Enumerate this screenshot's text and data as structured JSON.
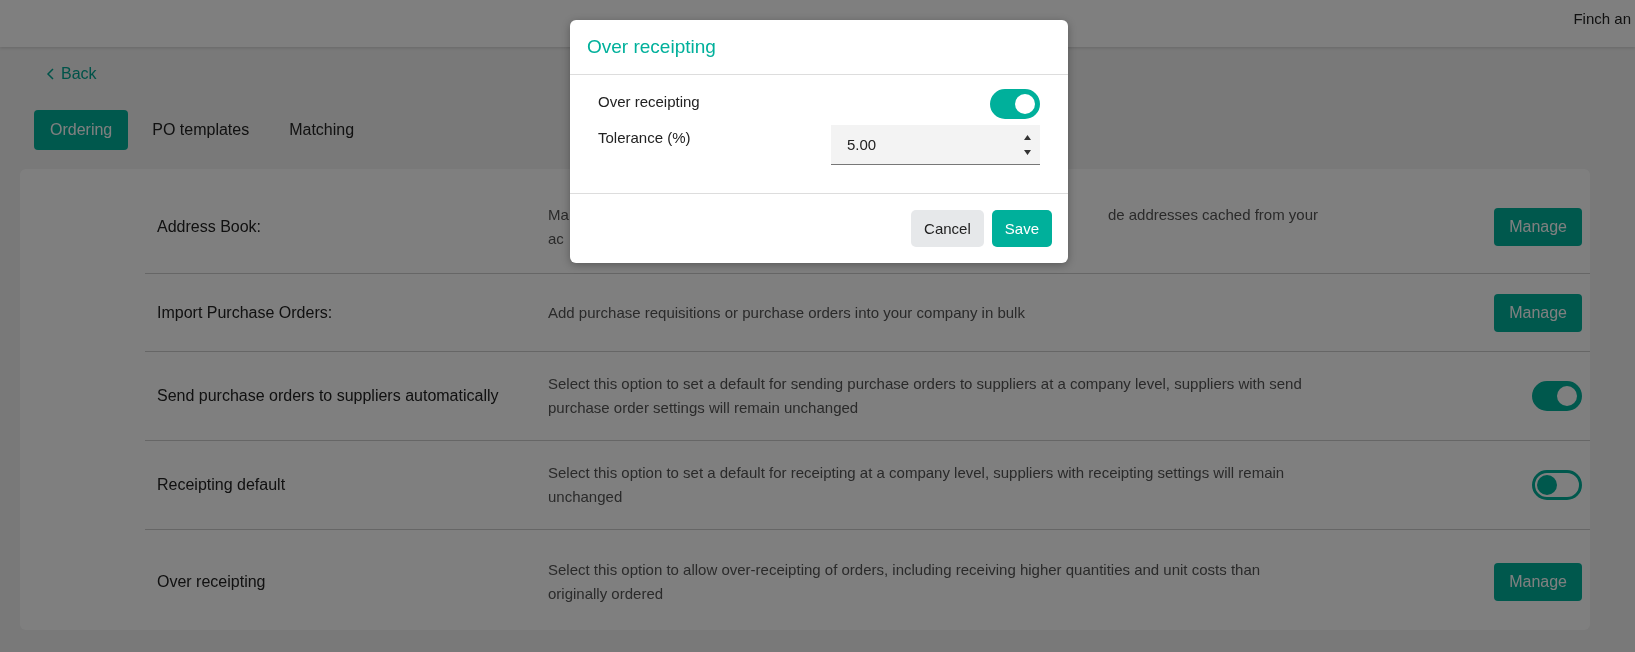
{
  "header": {
    "user": "Finch an"
  },
  "back_link": {
    "label": "Back"
  },
  "tabs": [
    {
      "label": "Ordering",
      "selected": true
    },
    {
      "label": "PO templates",
      "selected": false
    },
    {
      "label": "Matching",
      "selected": false
    }
  ],
  "settings": [
    {
      "label": "Address Book:",
      "description_lines": [
        [
          "Ma",
          "de addresses cached from your"
        ],
        [
          "ac"
        ]
      ],
      "kind": "button",
      "button": "Manage"
    },
    {
      "label": "Import Purchase Orders:",
      "description": "Add purchase requisitions or purchase orders into your company in bulk",
      "kind": "button",
      "button": "Manage"
    },
    {
      "label": "Send purchase orders to suppliers automatically",
      "description": "Select this option to set a default for sending purchase orders to suppliers at a company level, suppliers with send purchase order settings will remain unchanged",
      "kind": "toggle",
      "on": true
    },
    {
      "label": "Receipting default",
      "description": "Select this option to set a default for receipting at a company level, suppliers with receipting settings will remain unchanged",
      "kind": "toggle",
      "on": false
    },
    {
      "label": "Over receipting",
      "description": "Select this option to allow over-receipting of orders, including receiving higher quantities and unit costs than originally ordered",
      "kind": "button",
      "button": "Manage"
    }
  ],
  "dialog": {
    "title": "Over receipting",
    "fields": [
      {
        "label": "Over receipting",
        "kind": "toggle",
        "on": true
      },
      {
        "label": "Tolerance (%)",
        "kind": "number",
        "value": "5.00"
      }
    ],
    "buttons": [
      {
        "label": "Cancel",
        "kind": "secondary"
      },
      {
        "label": "Save",
        "kind": "primary"
      }
    ]
  }
}
